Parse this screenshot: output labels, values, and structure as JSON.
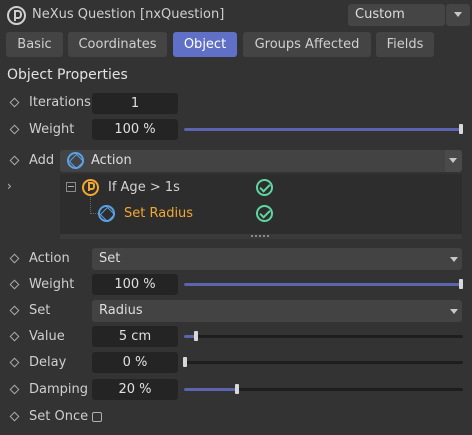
{
  "header": {
    "title": "NeXus Question [nxQuestion]",
    "preset": "Custom"
  },
  "tabs": [
    {
      "label": "Basic",
      "active": false
    },
    {
      "label": "Coordinates",
      "active": false
    },
    {
      "label": "Object",
      "active": true
    },
    {
      "label": "Groups Affected",
      "active": false
    },
    {
      "label": "Fields",
      "active": false
    }
  ],
  "section_title": "Object Properties",
  "iterations": {
    "label": "Iterations",
    "value": "1"
  },
  "weight1": {
    "label": "Weight",
    "value": "100 %",
    "slider": 1.0
  },
  "add": {
    "label": "Add",
    "value": "Action"
  },
  "list": {
    "question": {
      "label": "If Age > 1s",
      "color": "#c8c8c8"
    },
    "action": {
      "label": "Set Radius",
      "color": "#f0a830"
    }
  },
  "action": {
    "label": "Action",
    "value": "Set"
  },
  "weight2": {
    "label": "Weight",
    "value": "100 %",
    "slider": 1.0
  },
  "set": {
    "label": "Set",
    "value": "Radius"
  },
  "value": {
    "label": "Value",
    "value": "5 cm",
    "slider": 0.05
  },
  "delay": {
    "label": "Delay",
    "value": "0 %",
    "slider": 0.0
  },
  "damping": {
    "label": "Damping",
    "value": "20 %",
    "slider": 0.2
  },
  "set_once": {
    "label": "Set Once",
    "checked": false
  },
  "colors": {
    "accent": "#6070c6",
    "slider_fill": "#5c64b0",
    "check": "#5fd6a0",
    "question": "#f0a830",
    "action_icon": "#5aa0e6"
  }
}
